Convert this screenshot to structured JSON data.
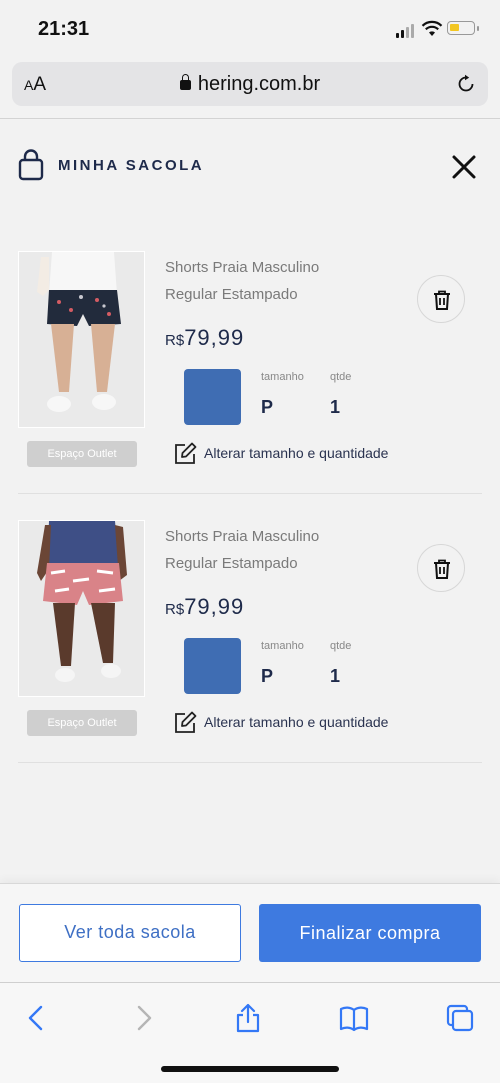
{
  "status_bar": {
    "time": "21:31"
  },
  "browser": {
    "text_size_small": "A",
    "text_size_large": "A",
    "url": "hering.com.br"
  },
  "bag": {
    "title": "MINHA SACOLA"
  },
  "items": [
    {
      "name_line1": "Shorts Praia Masculino",
      "name_line2": "Regular Estampado",
      "currency": "R$",
      "price": "79,99",
      "size_label": "tamanho",
      "size": "P",
      "qty_label": "qtde",
      "qty": "1",
      "color": "#3f6db3",
      "badge": "Espaço Outlet",
      "edit_label": "Alterar tamanho e quantidade"
    },
    {
      "name_line1": "Shorts Praia Masculino",
      "name_line2": "Regular Estampado",
      "currency": "R$",
      "price": "79,99",
      "size_label": "tamanho",
      "size": "P",
      "qty_label": "qtde",
      "qty": "1",
      "color": "#3f6db3",
      "badge": "Espaço Outlet",
      "edit_label": "Alterar tamanho e quantidade"
    }
  ],
  "footer": {
    "view_bag": "Ver toda sacola",
    "checkout": "Finalizar compra"
  },
  "colors": {
    "primary": "#3e7ae0",
    "navy": "#1e2a4a",
    "badge": "#cfcfcf"
  }
}
